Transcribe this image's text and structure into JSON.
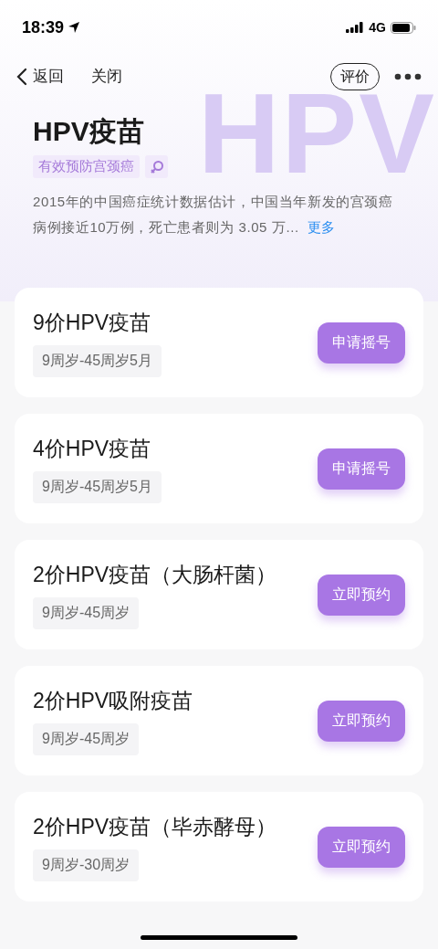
{
  "status_bar": {
    "time": "18:39",
    "network": "4G"
  },
  "nav": {
    "back": "返回",
    "close": "关闭",
    "rate": "评价"
  },
  "header": {
    "title": "HPV疫苗",
    "background_text": "HPV",
    "tag": "有效预防宫颈癌",
    "description": "2015年的中国癌症统计数据估计，中国当年新发的宫颈癌病例接近10万例，死亡患者则为 3.05 万...",
    "more": "更多"
  },
  "vaccines": [
    {
      "name": "9价HPV疫苗",
      "age": "9周岁-45周岁5月",
      "action": "申请摇号"
    },
    {
      "name": "4价HPV疫苗",
      "age": "9周岁-45周岁5月",
      "action": "申请摇号"
    },
    {
      "name": "2价HPV疫苗（大肠杆菌）",
      "age": "9周岁-45周岁",
      "action": "立即预约"
    },
    {
      "name": "2价HPV吸附疫苗",
      "age": "9周岁-45周岁",
      "action": "立即预约"
    },
    {
      "name": "2价HPV疫苗（毕赤酵母）",
      "age": "9周岁-30周岁",
      "action": "立即预约"
    }
  ]
}
